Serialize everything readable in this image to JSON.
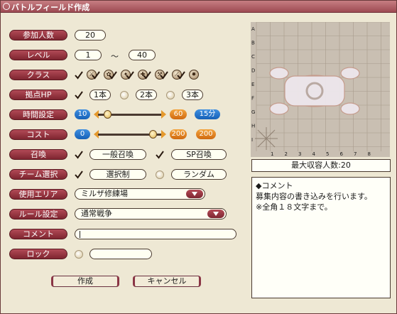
{
  "window": {
    "title": "バトルフィールド作成"
  },
  "labels": {
    "participants": "参加人数",
    "level": "レベル",
    "class": "クラス",
    "base_hp": "拠点HP",
    "time_setting": "時間設定",
    "cost": "コスト",
    "summon": "召喚",
    "team_select": "チーム選択",
    "area": "使用エリア",
    "rules": "ルール設定",
    "comment": "コメント",
    "lock": "ロック"
  },
  "participants": {
    "value": "20"
  },
  "level": {
    "min": "1",
    "separator": "〜",
    "max": "40"
  },
  "class_icons": [
    "sword-class-icon",
    "bow-class-icon",
    "wand-class-icon",
    "mace-class-icon",
    "staff-class-icon",
    "spear-class-icon",
    "crossed-blades-class-icon"
  ],
  "base_hp": {
    "options": [
      "1本",
      "2本",
      "3本"
    ],
    "selected": 0
  },
  "time_setting": {
    "min": "10",
    "max": "60",
    "selected": "15分"
  },
  "cost": {
    "min": "0",
    "max": "200",
    "selected": "200"
  },
  "summon": {
    "options": [
      "一般召喚",
      "SP召喚"
    ]
  },
  "team_select": {
    "options": [
      "選択制",
      "ランダム"
    ],
    "selected": 0
  },
  "area": {
    "selected": "ミルザ修練場"
  },
  "rules": {
    "selected": "通常戦争"
  },
  "comment_field": {
    "value": ""
  },
  "lock_field": {
    "value": ""
  },
  "buttons": {
    "create": "作成",
    "cancel": "キャンセル"
  },
  "map": {
    "row_labels": [
      "A",
      "B",
      "C",
      "D",
      "E",
      "F",
      "G",
      "H",
      "I"
    ],
    "col_labels": [
      "1",
      "2",
      "3",
      "4",
      "5",
      "6",
      "7",
      "8"
    ]
  },
  "capacity": {
    "text": "最大収容人数:20"
  },
  "comment_panel": {
    "title": "◆コメント",
    "line1": "募集内容の書き込みを行います。",
    "line2": "※全角１８文字まで。"
  },
  "colors": {
    "accent": "#8f3640",
    "panel": "#eee8d4",
    "blue": "#1e6fc6",
    "orange": "#e07c1a"
  }
}
